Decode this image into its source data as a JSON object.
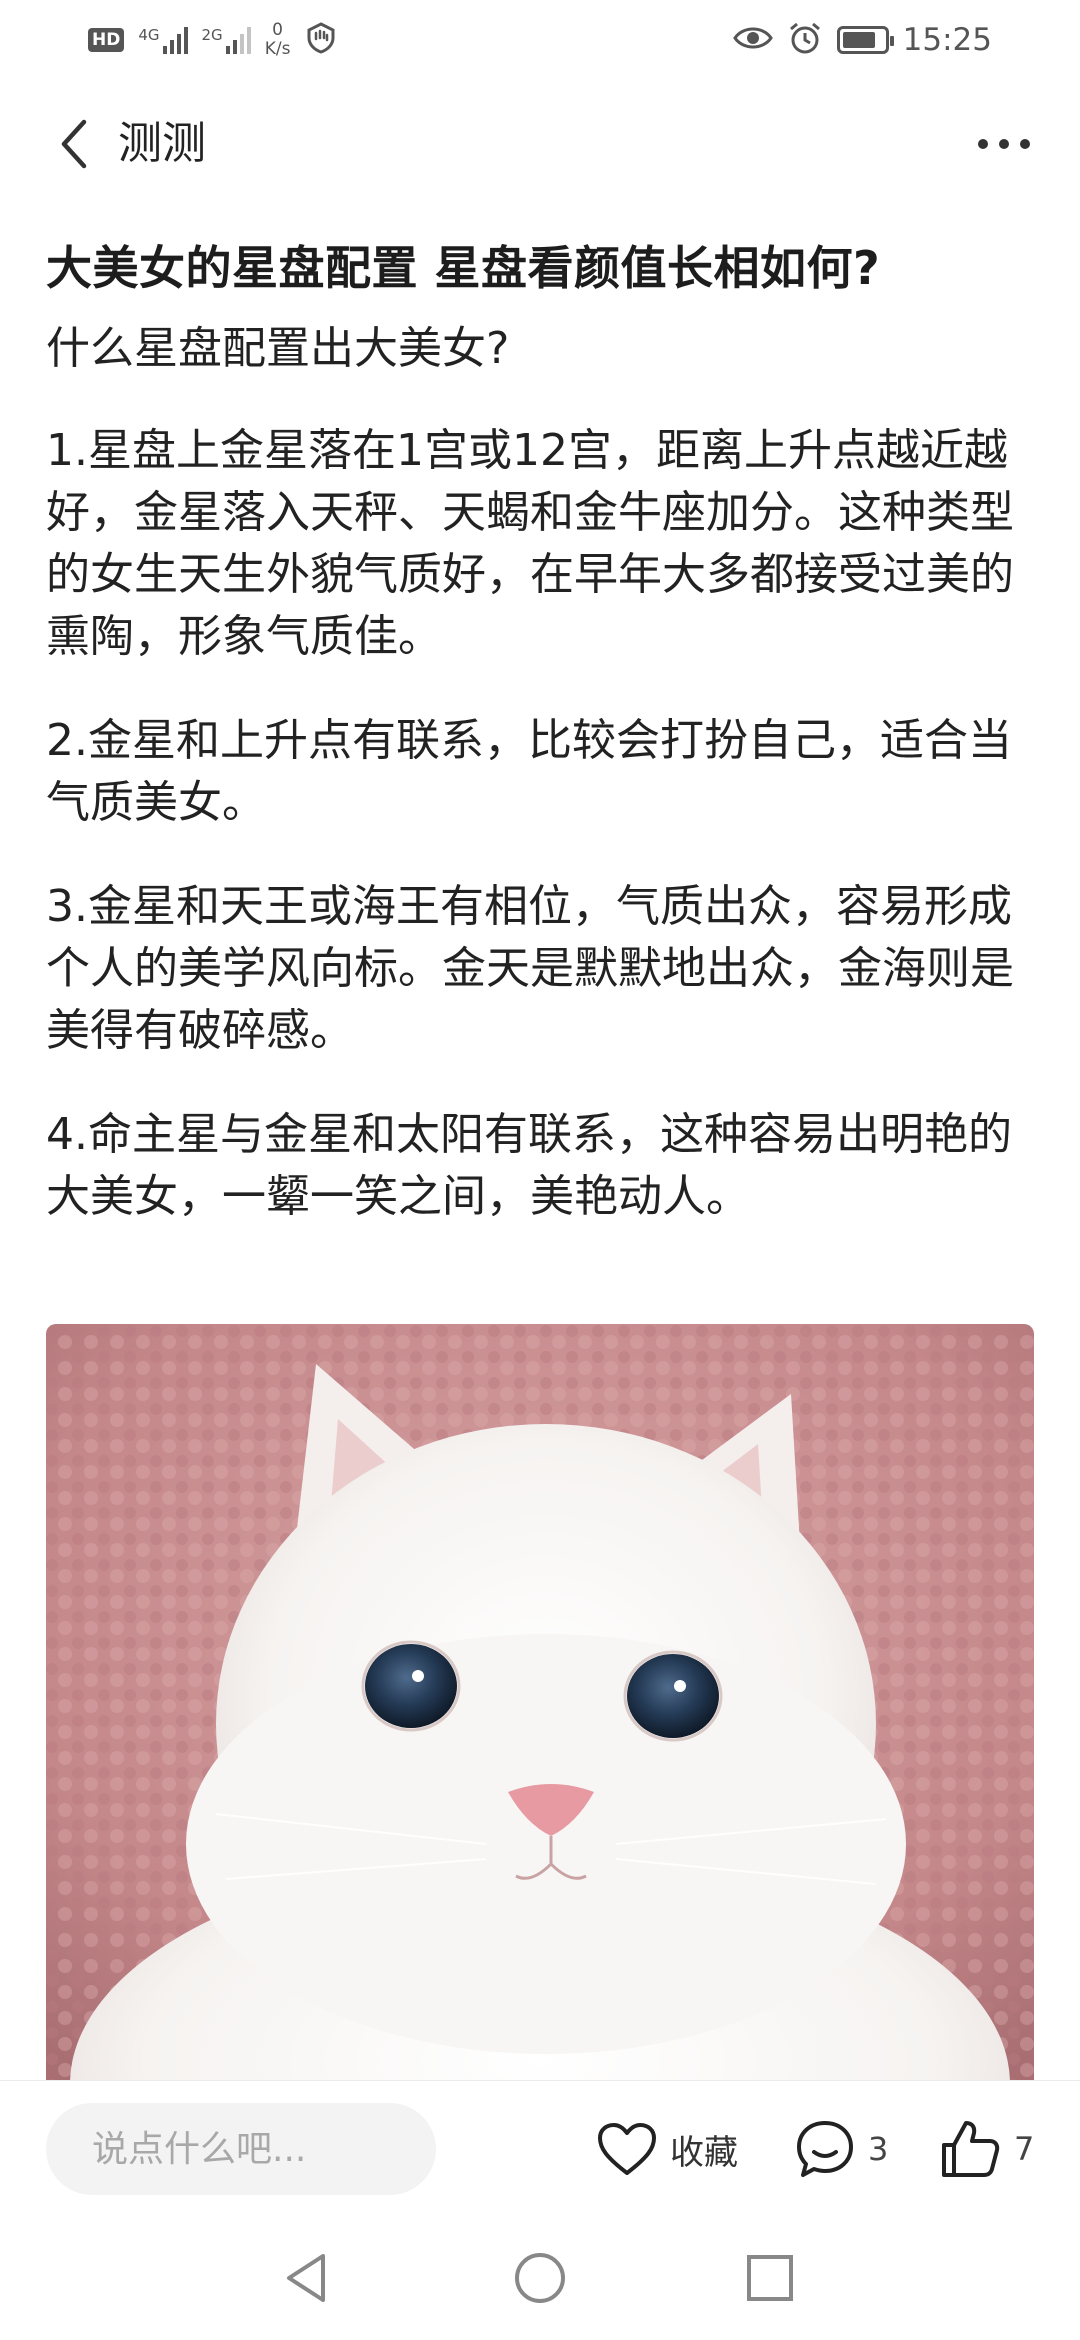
{
  "status_bar": {
    "hd": "HD",
    "sim1_net": "4G",
    "sim2_net": "2G",
    "speed_value": "0",
    "speed_unit": "K/s",
    "time": "15:25",
    "battery_level": 0.8,
    "icons": [
      "hd-icon",
      "signal-icon",
      "data-speed",
      "shield-icon",
      "eye-icon",
      "alarm-icon",
      "battery-icon"
    ]
  },
  "header": {
    "title": "测测"
  },
  "post": {
    "title": "大美女的星盘配置 星盘看颜值长相如何?",
    "subtitle": "什么星盘配置出大美女?",
    "paragraphs": [
      "1.星盘上金星落在1宫或12宫，距离上升点越近越好，金星落入天秤、天蝎和金牛座加分。这种类型的女生天生外貌气质好，在早年大多都接受过美的熏陶，形象气质佳。",
      "2.金星和上升点有联系，比较会打扮自己，适合当气质美女。",
      "3.金星和天王或海王有相位，气质出众，容易形成个人的美学风向标。金天是默默地出众，金海则是美得有破碎感。",
      "4.命主星与金星和太阳有联系，这种容易出明艳的大美女，一颦一笑之间，美艳动人。"
    ]
  },
  "action_bar": {
    "comment_placeholder": "说点什么吧...",
    "favorite_label": "收藏",
    "comment_count": "3",
    "like_count": "7"
  },
  "colors": {
    "text": "#222222",
    "towel_pink": "#c98b8d",
    "cat_white": "#f7f5f3"
  }
}
